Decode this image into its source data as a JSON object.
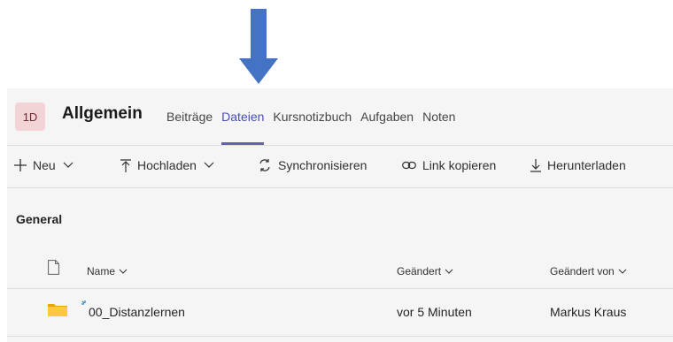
{
  "header": {
    "team_avatar": "1D",
    "team_name": "Allgemein",
    "tabs": [
      {
        "label": "Beiträge",
        "active": false
      },
      {
        "label": "Dateien",
        "active": true
      },
      {
        "label": "Kursnotizbuch",
        "active": false
      },
      {
        "label": "Aufgaben",
        "active": false
      },
      {
        "label": "Noten",
        "active": false
      }
    ]
  },
  "toolbar": {
    "new_label": "Neu",
    "upload_label": "Hochladen",
    "sync_label": "Synchronisieren",
    "copy_link_label": "Link kopieren",
    "download_label": "Herunterladen"
  },
  "folder": {
    "breadcrumb": "General"
  },
  "table": {
    "columns": {
      "name": "Name",
      "modified": "Geändert",
      "modified_by": "Geändert von"
    },
    "rows": [
      {
        "name": "00_Distanzlernen",
        "modified": "vor 5 Minuten",
        "modified_by": "Markus Kraus",
        "icon": "folder-icon"
      }
    ]
  },
  "colors": {
    "accent": "#6264a7",
    "arrow": "#4472c4",
    "folder": "#ffb900",
    "avatar_bg": "#f3d4d6"
  }
}
